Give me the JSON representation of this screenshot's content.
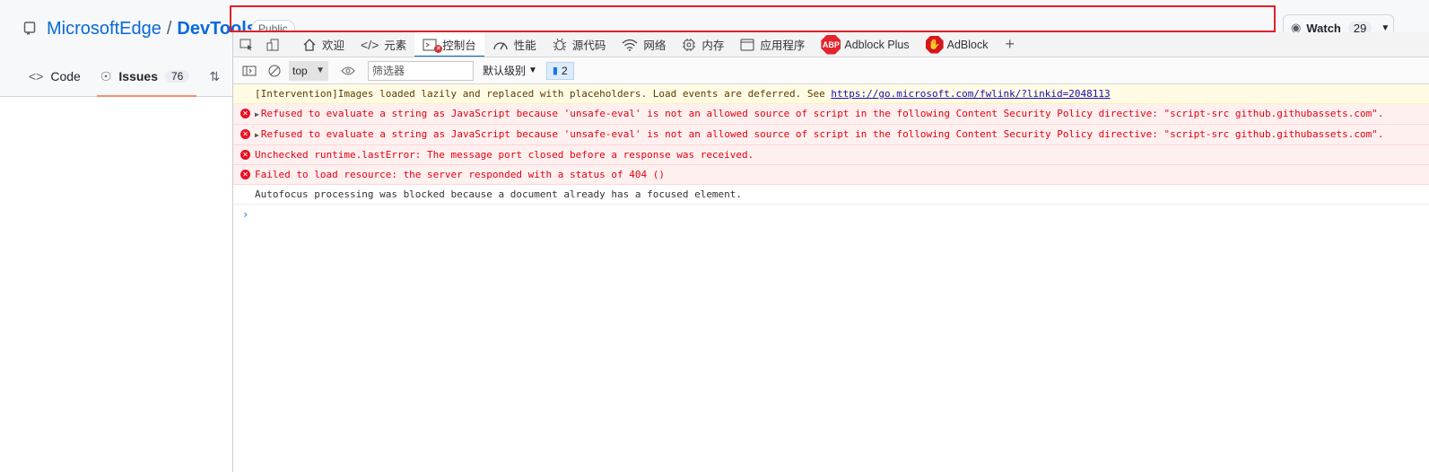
{
  "github": {
    "owner": "MicrosoftEdge",
    "separator": "/",
    "repo": "DevTools",
    "visibility": "Public",
    "watch_label": "Watch",
    "watch_count": "29",
    "tabs": [
      {
        "label": "Code",
        "icon": "code-icon"
      },
      {
        "label": "Issues",
        "icon": "issues-icon",
        "count": "76"
      }
    ]
  },
  "devtools": {
    "tabs": [
      {
        "label": "欢迎",
        "icon": "home-icon"
      },
      {
        "label": "元素",
        "icon": "code-icon"
      },
      {
        "label": "控制台",
        "icon": "console-icon",
        "active": true
      },
      {
        "label": "性能",
        "icon": "performance-icon"
      },
      {
        "label": "源代码",
        "icon": "bug-icon"
      },
      {
        "label": "网络",
        "icon": "wifi-icon"
      },
      {
        "label": "内存",
        "icon": "memory-icon"
      },
      {
        "label": "应用程序",
        "icon": "application-icon"
      },
      {
        "label": "Adblock Plus",
        "icon": "abp-icon"
      },
      {
        "label": "AdBlock",
        "icon": "adblock-icon"
      }
    ],
    "abp_glyph": "ABP",
    "toolbar": {
      "context": "top",
      "filter_placeholder": "筛选器",
      "level": "默认级别",
      "issues_count": "2"
    },
    "messages": [
      {
        "type": "warn",
        "text": "[Intervention]Images loaded lazily and replaced with placeholders. Load events are deferred. See ",
        "link": "https://go.microsoft.com/fwlink/?linkid=2048113"
      },
      {
        "type": "error",
        "expandable": true,
        "text": "Refused to evaluate a string as JavaScript because 'unsafe-eval' is not an allowed source of script in the following Content Security Policy directive: \"script-src github.githubassets.com\"."
      },
      {
        "type": "error",
        "expandable": true,
        "text": "Refused to evaluate a string as JavaScript because 'unsafe-eval' is not an allowed source of script in the following Content Security Policy directive: \"script-src github.githubassets.com\"."
      },
      {
        "type": "error",
        "text": "Unchecked runtime.lastError: The message port closed before a response was received."
      },
      {
        "type": "error",
        "text": "Failed to load resource: the server responded with a status of 404 ()"
      },
      {
        "type": "info",
        "text": "Autofocus processing was blocked because a document already has a focused element."
      }
    ]
  },
  "colors": {
    "highlight_border": "#e0202a",
    "error_text": "#e4000f",
    "link": "#0969da",
    "active_tab": "#0067c0"
  }
}
